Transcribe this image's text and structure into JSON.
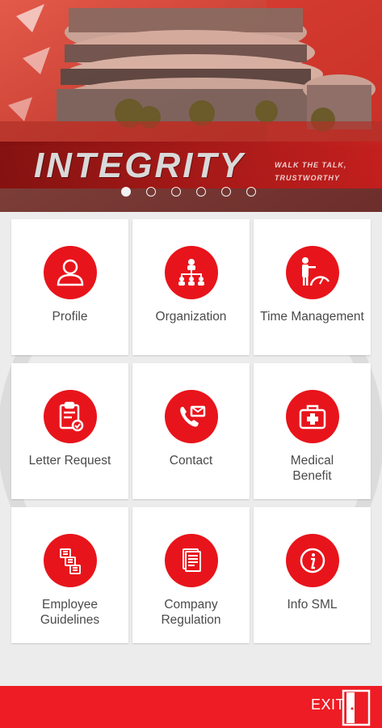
{
  "banner": {
    "title": "INTEGRITY",
    "tagline_line1": "WALK THE TALK,",
    "tagline_line2": "TRUSTWORTHY",
    "slide_count": 6,
    "active_slide": 1
  },
  "menu": [
    {
      "id": "profile",
      "label": "Profile",
      "icon": "user-icon"
    },
    {
      "id": "organization",
      "label": "Organization",
      "icon": "org-chart-icon"
    },
    {
      "id": "time-management",
      "label": "Time Management",
      "icon": "speedometer-person-icon"
    },
    {
      "id": "letter-request",
      "label": "Letter Request",
      "icon": "clipboard-check-icon"
    },
    {
      "id": "contact",
      "label": "Contact",
      "icon": "phone-mail-icon"
    },
    {
      "id": "medical-benefit",
      "label1": "Medical",
      "label2": "Benefit",
      "icon": "medical-kit-icon"
    },
    {
      "id": "employee-guidelines",
      "label1": "Employee",
      "label2": "Guidelines",
      "icon": "documents-icon"
    },
    {
      "id": "company-regulation",
      "label1": "Company",
      "label2": "Regulation",
      "icon": "document-stack-icon"
    },
    {
      "id": "info-sml",
      "label": "Info SML",
      "icon": "info-icon"
    }
  ],
  "footer": {
    "exit_label": "EXIT"
  },
  "colors": {
    "accent": "#e8141b",
    "footer": "#ee1c24",
    "tile": "#ffffff",
    "background": "#ececec"
  }
}
